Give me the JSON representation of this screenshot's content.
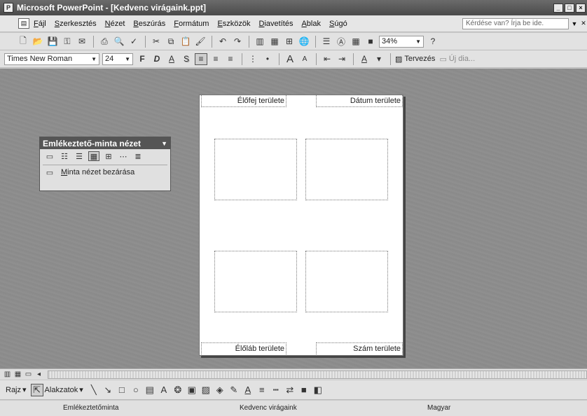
{
  "window": {
    "title": "Microsoft PowerPoint - [Kedvenc virágaink.ppt]",
    "minimize": "_",
    "restore": "□",
    "close": "×"
  },
  "menu": {
    "items": [
      "Fájl",
      "Szerkesztés",
      "Nézet",
      "Beszúrás",
      "Formátum",
      "Eszközök",
      "Diavetítés",
      "Ablak",
      "Súgó"
    ],
    "ask_placeholder": "Kérdése van? Írja be ide."
  },
  "toolbar1": {
    "zoom": "34%"
  },
  "toolbar2": {
    "font": "Times New Roman",
    "size": "24",
    "bold": "F",
    "italic": "D",
    "underline": "A",
    "shadow": "S",
    "design": "Tervezés",
    "new_slide": "Új dia..."
  },
  "float_toolbar": {
    "title": "Emlékeztető-minta nézet",
    "close_label": "Minta nézet bezárása"
  },
  "slide": {
    "header": "Élőfej területe",
    "date": "Dátum területe",
    "footer": "Élőláb területe",
    "number": "Szám területe"
  },
  "drawing": {
    "draw": "Rajz",
    "shapes": "Alakzatok"
  },
  "status": {
    "view": "Emlékeztetőminta",
    "file": "Kedvenc virágaink",
    "language": "Magyar"
  }
}
